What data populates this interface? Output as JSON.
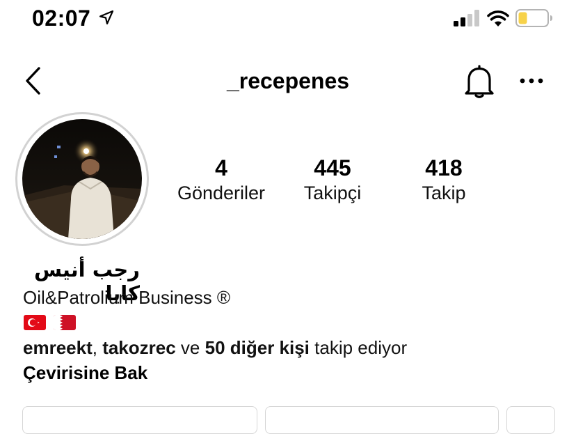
{
  "status_bar": {
    "time": "02:07"
  },
  "header": {
    "username": "_recepenes"
  },
  "stats": [
    {
      "value": "4",
      "label": "Gönderiler"
    },
    {
      "value": "445",
      "label": "Takipçi"
    },
    {
      "value": "418",
      "label": "Takip"
    }
  ],
  "profile": {
    "full_name": "رجب أنيس كايا",
    "bio": "Oil&Patrolium Business ®",
    "flags": [
      "turkey-flag",
      "bahrain-flag"
    ]
  },
  "followed_by": {
    "user1": "emreekt",
    "separator": ", ",
    "user2": "takozrec",
    "conjunction": " ve ",
    "others": "50 diğer kişi",
    "suffix": " takip ediyor"
  },
  "translate_label": "Çevirisine Bak",
  "colors": {
    "battery": "#f7d24a",
    "text": "#000000",
    "ring": "#d2d2d2"
  }
}
